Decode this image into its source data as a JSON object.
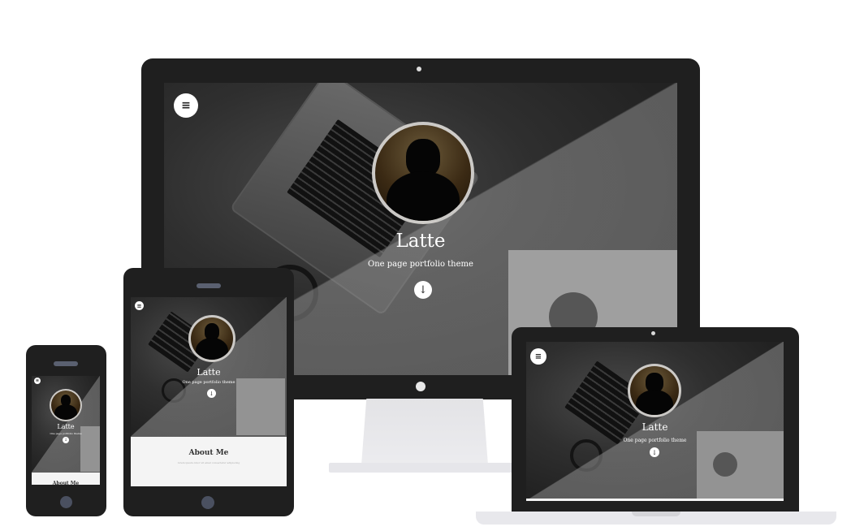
{
  "hero": {
    "title": "Latte",
    "subtitle": "One page portfolio theme",
    "menu_icon": "menu-icon",
    "down_icon": "arrow-down-circle-icon"
  },
  "about": {
    "heading": "About Me",
    "text": "lorem ipsum dolor sit amet consectetur adipiscing"
  },
  "colors": {
    "device": "#1f1f1f",
    "accent": "#ffffff",
    "panel": "#f4f4f4"
  }
}
